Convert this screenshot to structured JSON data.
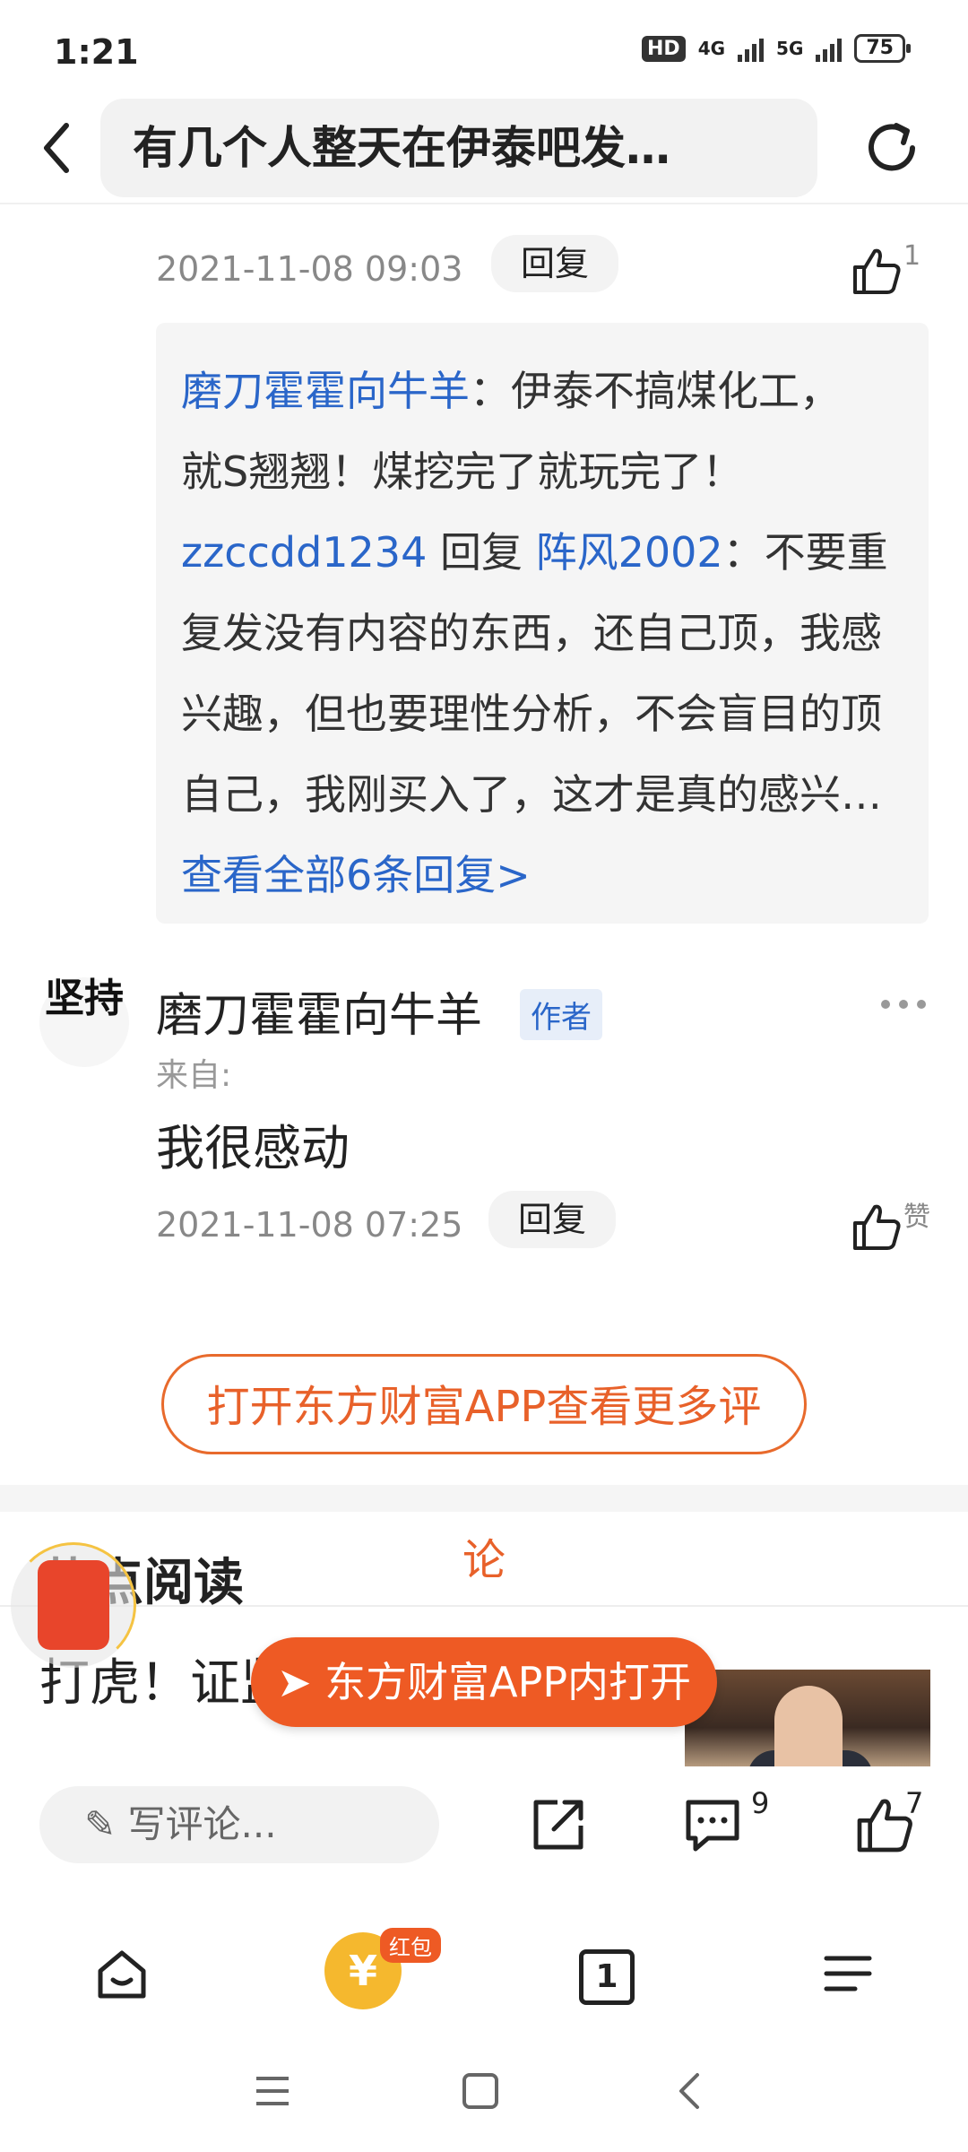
{
  "status_bar": {
    "time": "1:21",
    "hd_badge": "HD",
    "net1": "4G",
    "net2": "5G",
    "battery": "75"
  },
  "header": {
    "title": "有几个人整天在伊泰吧发…",
    "back_icon": "chevron-left-icon",
    "refresh_icon": "refresh-icon"
  },
  "comment1": {
    "date": "2021-11-08 09:03",
    "reply_label": "回复",
    "like_count": "1",
    "replies": [
      {
        "author": "磨刀霍霍向牛羊",
        "text_lines": [
          "：伊泰不搞煤化工，",
          "就S翘翘！煤挖完了就玩完了！"
        ]
      },
      {
        "author": "zzccdd1234",
        "reply_word": "回复",
        "target": "阵风2002",
        "text_lines": [
          "：不要重",
          "复发没有内容的东西，还自己顶，我感",
          "兴趣，但也要理性分析，不会盲目的顶",
          "自己，我刚买入了，这才是真的感兴…"
        ]
      }
    ],
    "view_all": "查看全部6条回复>"
  },
  "comment2": {
    "avatar_text": "坚持",
    "name": "磨刀霍霍向牛羊",
    "badge": "作者",
    "from": "来自:",
    "text": "我很感动",
    "date": "2021-11-08 07:25",
    "reply_label": "回复",
    "like_label": "赞"
  },
  "open_app": {
    "label_line1": "打开东方财富APP查看更多评",
    "label_line2": "论"
  },
  "hot_reading": {
    "title": "热点阅读",
    "news_title": "打虎！证监会满被查"
  },
  "floating_button": "东方财富APP内打开",
  "comment_bar": {
    "placeholder": "写评论...",
    "comment_count": "9",
    "like_count": "7"
  },
  "bottom_nav": {
    "red_badge": "红包",
    "tab_count": "1"
  },
  "colors": {
    "accent_orange": "#ee5a24",
    "link_blue": "#2a66c9"
  }
}
